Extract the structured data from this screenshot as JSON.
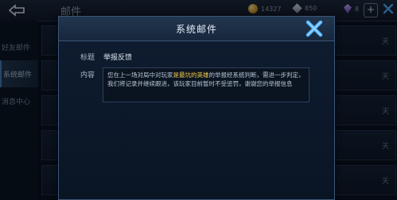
{
  "topbar": {
    "title": "邮件",
    "gold": "14327",
    "silver": "850",
    "gems": "8"
  },
  "sidebar": {
    "items": [
      {
        "label": "好友邮件"
      },
      {
        "label": "系统邮件"
      },
      {
        "label": "消息中心"
      }
    ]
  },
  "list": {
    "rows": [
      {
        "day": "天"
      },
      {
        "day": "天"
      },
      {
        "day": "天"
      },
      {
        "day": "天"
      },
      {
        "day": "天"
      }
    ]
  },
  "modal": {
    "title": "系统邮件",
    "subject_label": "标题",
    "subject_value": "举报反馈",
    "content_label": "内容",
    "content_before": "您在上一场对局中对玩家",
    "content_highlight": "是最坑的英雄",
    "content_after": "的举报经系统判断，需进一步判定，我们将记录并继续跟进，该玩家目前暂时不受惩罚，谢谢您的举报信息"
  },
  "colors": {
    "accent_blue": "#4db0ff",
    "highlight_yellow": "#f2cc4c"
  }
}
